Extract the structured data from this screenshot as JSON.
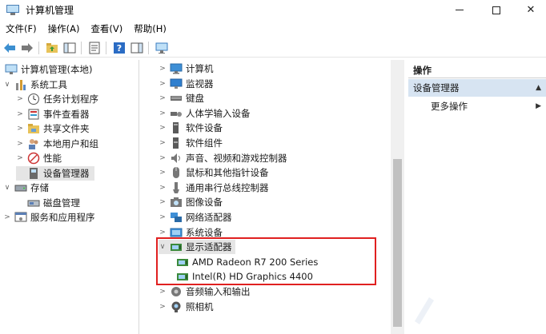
{
  "window": {
    "title": "计算机管理"
  },
  "menu": [
    "文件(F)",
    "操作(A)",
    "查看(V)",
    "帮助(H)"
  ],
  "left_tree": [
    {
      "label": "计算机管理(本地)",
      "level": 0,
      "expander": "",
      "icon": "computer-management-icon"
    },
    {
      "label": "系统工具",
      "level": 1,
      "expander": "∨",
      "icon": "system-tools-icon"
    },
    {
      "label": "任务计划程序",
      "level": 2,
      "expander": ">",
      "icon": "task-scheduler-icon"
    },
    {
      "label": "事件查看器",
      "level": 2,
      "expander": ">",
      "icon": "event-viewer-icon"
    },
    {
      "label": "共享文件夹",
      "level": 2,
      "expander": ">",
      "icon": "shared-folders-icon"
    },
    {
      "label": "本地用户和组",
      "level": 2,
      "expander": ">",
      "icon": "local-users-icon"
    },
    {
      "label": "性能",
      "level": 2,
      "expander": ">",
      "icon": "performance-icon"
    },
    {
      "label": "设备管理器",
      "level": 2,
      "expander": "",
      "icon": "device-manager-icon",
      "selected": true
    },
    {
      "label": "存储",
      "level": 1,
      "expander": "∨",
      "icon": "storage-icon"
    },
    {
      "label": "磁盘管理",
      "level": 2,
      "expander": "",
      "icon": "disk-management-icon"
    },
    {
      "label": "服务和应用程序",
      "level": 1,
      "expander": ">",
      "icon": "services-icon"
    }
  ],
  "devices": [
    {
      "label": "计算机",
      "expander": ">",
      "icon": "computer-icon"
    },
    {
      "label": "监视器",
      "expander": ">",
      "icon": "monitor-icon"
    },
    {
      "label": "键盘",
      "expander": ">",
      "icon": "keyboard-icon"
    },
    {
      "label": "人体学输入设备",
      "expander": ">",
      "icon": "hid-icon"
    },
    {
      "label": "软件设备",
      "expander": ">",
      "icon": "software-device-icon"
    },
    {
      "label": "软件组件",
      "expander": ">",
      "icon": "software-component-icon"
    },
    {
      "label": "声音、视频和游戏控制器",
      "expander": ">",
      "icon": "sound-icon"
    },
    {
      "label": "鼠标和其他指针设备",
      "expander": ">",
      "icon": "mouse-icon"
    },
    {
      "label": "通用串行总线控制器",
      "expander": ">",
      "icon": "usb-icon"
    },
    {
      "label": "图像设备",
      "expander": ">",
      "icon": "imaging-device-icon"
    },
    {
      "label": "网络适配器",
      "expander": ">",
      "icon": "network-adapter-icon"
    },
    {
      "label": "系统设备",
      "expander": ">",
      "icon": "system-device-icon"
    },
    {
      "label": "显示适配器",
      "expander": "∨",
      "icon": "display-adapter-icon",
      "selected": true
    },
    {
      "label": "AMD Radeon R7 200 Series",
      "expander": "",
      "icon": "display-adapter-icon",
      "child": true
    },
    {
      "label": "Intel(R) HD Graphics 4400",
      "expander": "",
      "icon": "display-adapter-icon",
      "child": true
    },
    {
      "label": "音频输入和输出",
      "expander": ">",
      "icon": "audio-io-icon"
    },
    {
      "label": "照相机",
      "expander": ">",
      "icon": "camera-icon"
    }
  ],
  "actions": {
    "header": "操作",
    "section": "设备管理器",
    "more": "更多操作"
  },
  "colors": {
    "selection": "#e5e5e5",
    "highlight_box": "#e02020",
    "actions_band": "#d7e4f2"
  }
}
